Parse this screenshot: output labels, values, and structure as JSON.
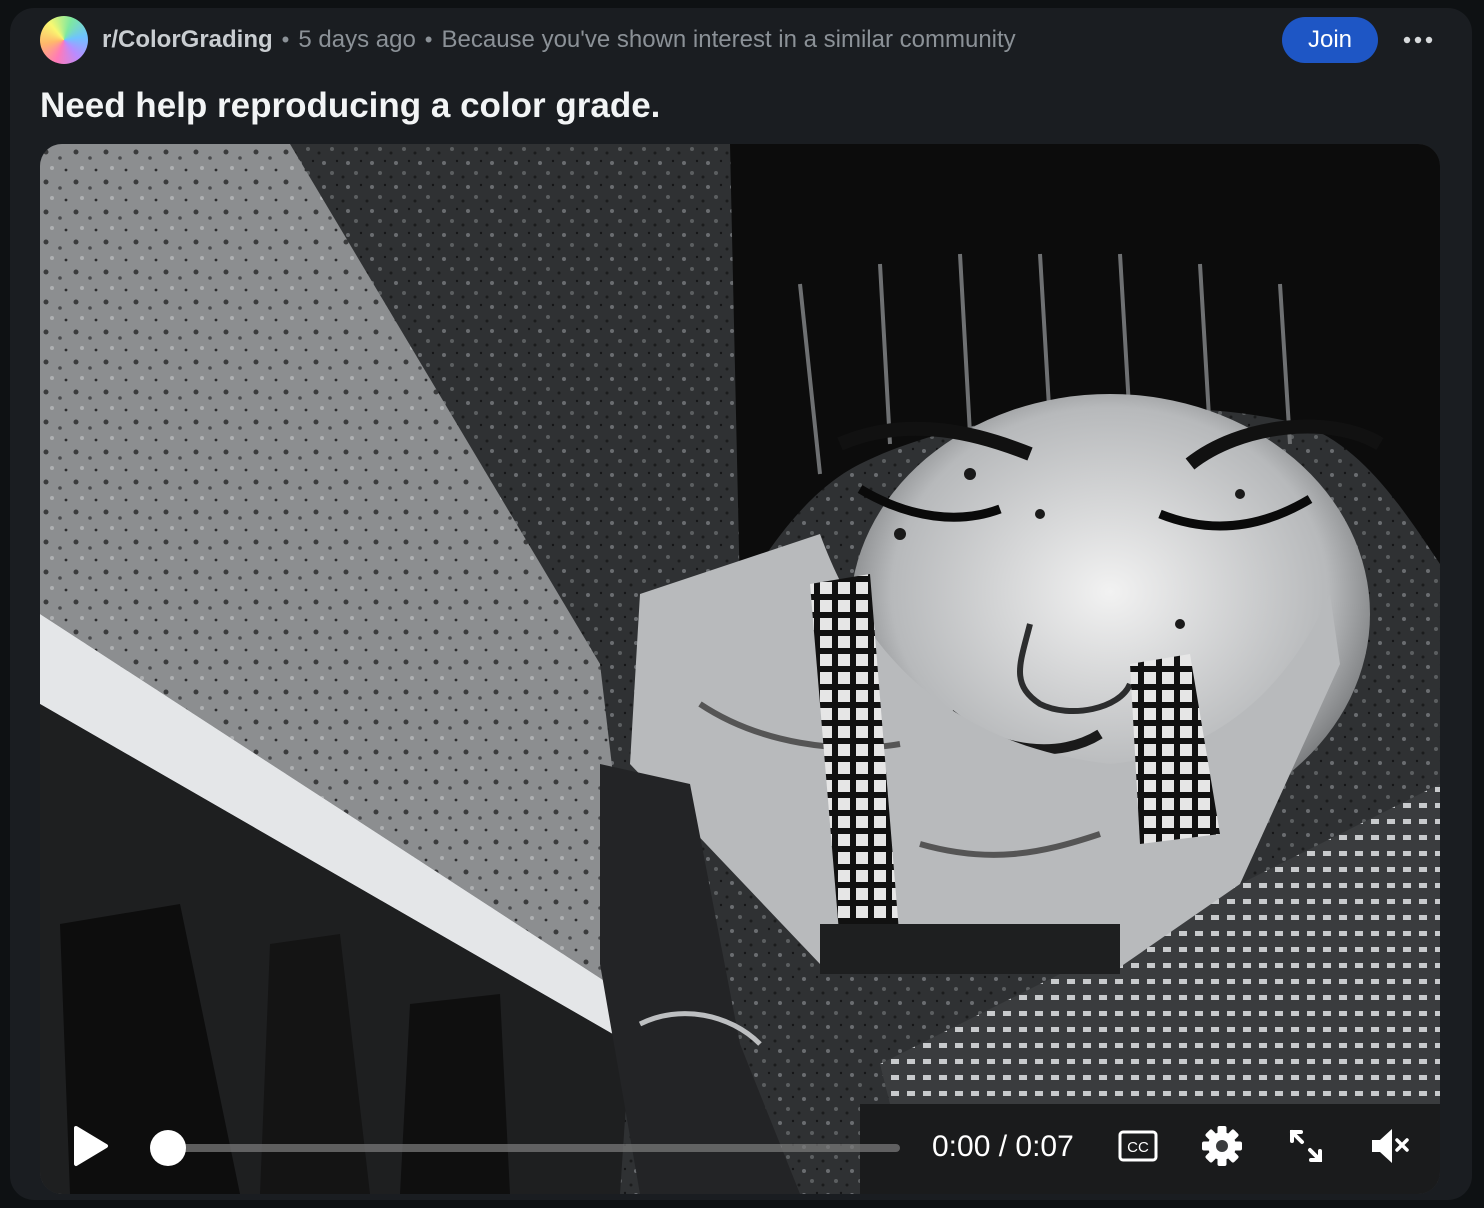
{
  "post": {
    "subreddit": "r/ColorGrading",
    "separator": "•",
    "time": "5 days ago",
    "reason": "Because you've shown interest in a similar community",
    "join_label": "Join",
    "title": "Need help reproducing a color grade."
  },
  "icons": {
    "avatar": "subreddit-avatar",
    "more": "more-options-icon",
    "play": "play-icon",
    "captions": "closed-captions-icon",
    "settings": "gear-icon",
    "fullscreen": "fullscreen-icon",
    "mute": "muted-speaker-icon"
  },
  "video": {
    "current_time": "0:00",
    "duration": "0:07",
    "time_display": "0:00 / 0:07",
    "progress_fraction": 0.0,
    "muted": true,
    "captions_label": "CC"
  },
  "colors": {
    "accent": "#1e56c5",
    "card_bg": "#1a1d21",
    "page_bg": "#0e1113"
  }
}
